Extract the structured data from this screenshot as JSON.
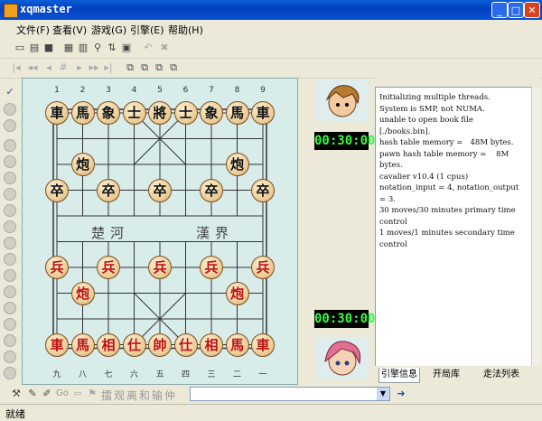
{
  "window": {
    "title": "xqmaster"
  },
  "menu": [
    "文件(F)",
    "查看(V)",
    "游戏(G)",
    "引擎(E)",
    "帮助(H)"
  ],
  "board": {
    "top_files": [
      "1",
      "2",
      "3",
      "4",
      "5",
      "6",
      "7",
      "8",
      "9"
    ],
    "bottom_files": [
      "九",
      "八",
      "七",
      "六",
      "五",
      "四",
      "三",
      "二",
      "一"
    ],
    "river_left": "楚河",
    "river_right": "漢界",
    "black_pieces": [
      {
        "ch": "車",
        "f": 0,
        "r": 0
      },
      {
        "ch": "馬",
        "f": 1,
        "r": 0
      },
      {
        "ch": "象",
        "f": 2,
        "r": 0
      },
      {
        "ch": "士",
        "f": 3,
        "r": 0
      },
      {
        "ch": "將",
        "f": 4,
        "r": 0
      },
      {
        "ch": "士",
        "f": 5,
        "r": 0
      },
      {
        "ch": "象",
        "f": 6,
        "r": 0
      },
      {
        "ch": "馬",
        "f": 7,
        "r": 0
      },
      {
        "ch": "車",
        "f": 8,
        "r": 0
      },
      {
        "ch": "炮",
        "f": 1,
        "r": 2
      },
      {
        "ch": "炮",
        "f": 7,
        "r": 2
      },
      {
        "ch": "卒",
        "f": 0,
        "r": 3
      },
      {
        "ch": "卒",
        "f": 2,
        "r": 3
      },
      {
        "ch": "卒",
        "f": 4,
        "r": 3
      },
      {
        "ch": "卒",
        "f": 6,
        "r": 3
      },
      {
        "ch": "卒",
        "f": 8,
        "r": 3
      }
    ],
    "red_pieces": [
      {
        "ch": "兵",
        "f": 0,
        "r": 6
      },
      {
        "ch": "兵",
        "f": 2,
        "r": 6
      },
      {
        "ch": "兵",
        "f": 4,
        "r": 6
      },
      {
        "ch": "兵",
        "f": 6,
        "r": 6
      },
      {
        "ch": "兵",
        "f": 8,
        "r": 6
      },
      {
        "ch": "炮",
        "f": 1,
        "r": 7
      },
      {
        "ch": "炮",
        "f": 7,
        "r": 7
      },
      {
        "ch": "車",
        "f": 0,
        "r": 9
      },
      {
        "ch": "馬",
        "f": 1,
        "r": 9
      },
      {
        "ch": "相",
        "f": 2,
        "r": 9
      },
      {
        "ch": "仕",
        "f": 3,
        "r": 9
      },
      {
        "ch": "帥",
        "f": 4,
        "r": 9
      },
      {
        "ch": "仕",
        "f": 5,
        "r": 9
      },
      {
        "ch": "相",
        "f": 6,
        "r": 9
      },
      {
        "ch": "馬",
        "f": 7,
        "r": 9
      },
      {
        "ch": "車",
        "f": 8,
        "r": 9
      }
    ]
  },
  "clocks": {
    "top": "00:30:00",
    "bottom": "00:30:00"
  },
  "console_text": "Initializing multiple threads.\nSystem is SMP, not NUMA.\nunable to open book file\n[./books.bin].\nhash table memory =   48M bytes.\npawn hash table memory =    8M\nbytes.\ncavalier v10.4 (1 cpus)\nnotation_input = 4, notation_output\n= 3.\n30 moves/30 minutes primary time\ncontrol\n1 moves/1 minutes secondary time\ncontrol",
  "tabs": [
    "引擎信息",
    "开局库",
    "走法列表"
  ],
  "bottom_toolbar": {
    "go": "Go",
    "notation_chars": "擂观离和输仲"
  },
  "status": "就绪",
  "colors": {
    "titlebar": "#0a52d0",
    "clock_text": "#30ff40",
    "red_piece": "#c01010"
  }
}
